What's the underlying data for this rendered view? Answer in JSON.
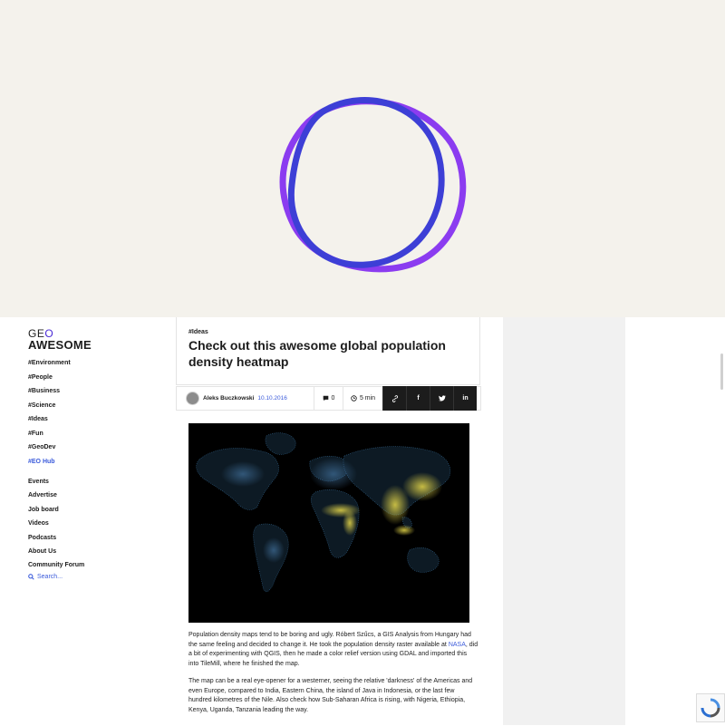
{
  "logo": {
    "line1_a": "GE",
    "line1_b": "O",
    "line2": "AWESOME"
  },
  "sidebar": {
    "tags": [
      {
        "label": "#Environment"
      },
      {
        "label": "#People"
      },
      {
        "label": "#Business"
      },
      {
        "label": "#Science"
      },
      {
        "label": "#Ideas"
      },
      {
        "label": "#Fun"
      },
      {
        "label": "#GeoDev"
      },
      {
        "label": "#EO Hub"
      }
    ],
    "links": [
      {
        "label": "Events"
      },
      {
        "label": "Advertise"
      },
      {
        "label": "Job board"
      },
      {
        "label": "Videos"
      },
      {
        "label": "Podcasts"
      },
      {
        "label": "About Us"
      },
      {
        "label": "Community Forum"
      }
    ],
    "search_label": "Search..."
  },
  "article": {
    "tag": "#Ideas",
    "title": "Check out this awesome global population density heatmap",
    "author": "Aleks Buczkowski",
    "date": "10.10.2016",
    "comments": "0",
    "read_time": "5 min",
    "share": [
      "link-icon",
      "facebook-icon",
      "twitter-icon",
      "linkedin-icon"
    ],
    "p1_a": "Population density maps tend to be boring and ugly. Róbert Szűcs, a GIS Analysis from Hungary had the same feeling and decided to change it. He took the population density raster available at ",
    "p1_link": "NASA",
    "p1_b": ", did a bit of experimenting with QGIS, then he made a color relief version using GDAL and imported this into TileMill, where he finished the map.",
    "p2": "The map can be a real eye-opener for a westerner, seeing the relative 'darkness' of the Americas and even Europe, compared to India, Eastern China, the island of Java in Indonesia, or the last few hundred kilometres of the Nile. Also check how Sub-Saharan Africa is rising, with Nigeria, Ethiopia, Kenya, Uganda, Tanzania leading the way."
  },
  "colors": {
    "accent": "#3b5bdb",
    "loader_blue": "#3d3fd6",
    "loader_purple": "#8b3cf0",
    "hero_bg": "#f4f2ec"
  }
}
